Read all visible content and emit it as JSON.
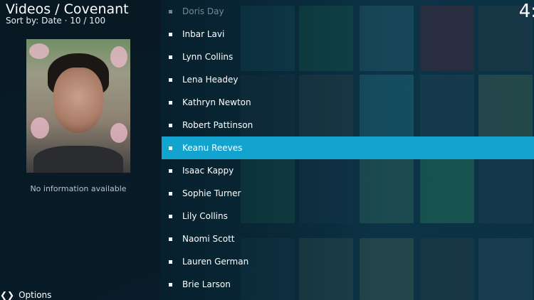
{
  "header": {
    "title": "Videos / Covenant",
    "subtitle": "Sort by: Date  ·  10 / 100",
    "clock": "4:"
  },
  "info_panel": {
    "thumbnail_label": "actor-thumbnail",
    "no_info_text": "No information available"
  },
  "footer": {
    "options_label": "Options"
  },
  "list": {
    "items": [
      {
        "label": "Doris Day",
        "state": "dim"
      },
      {
        "label": "Inbar Lavi",
        "state": "normal"
      },
      {
        "label": "Lynn Collins",
        "state": "normal"
      },
      {
        "label": "Lena Headey",
        "state": "normal"
      },
      {
        "label": "Kathryn Newton",
        "state": "normal"
      },
      {
        "label": "Robert Pattinson",
        "state": "normal"
      },
      {
        "label": "Keanu Reeves",
        "state": "selected"
      },
      {
        "label": "Isaac Kappy",
        "state": "normal"
      },
      {
        "label": "Sophie Turner",
        "state": "normal"
      },
      {
        "label": "Lily Collins",
        "state": "normal"
      },
      {
        "label": "Naomi Scott",
        "state": "normal"
      },
      {
        "label": "Lauren German",
        "state": "normal"
      },
      {
        "label": "Brie Larson",
        "state": "normal"
      }
    ]
  },
  "colors": {
    "selection": "#12a3cf",
    "background": "#0a2230"
  }
}
